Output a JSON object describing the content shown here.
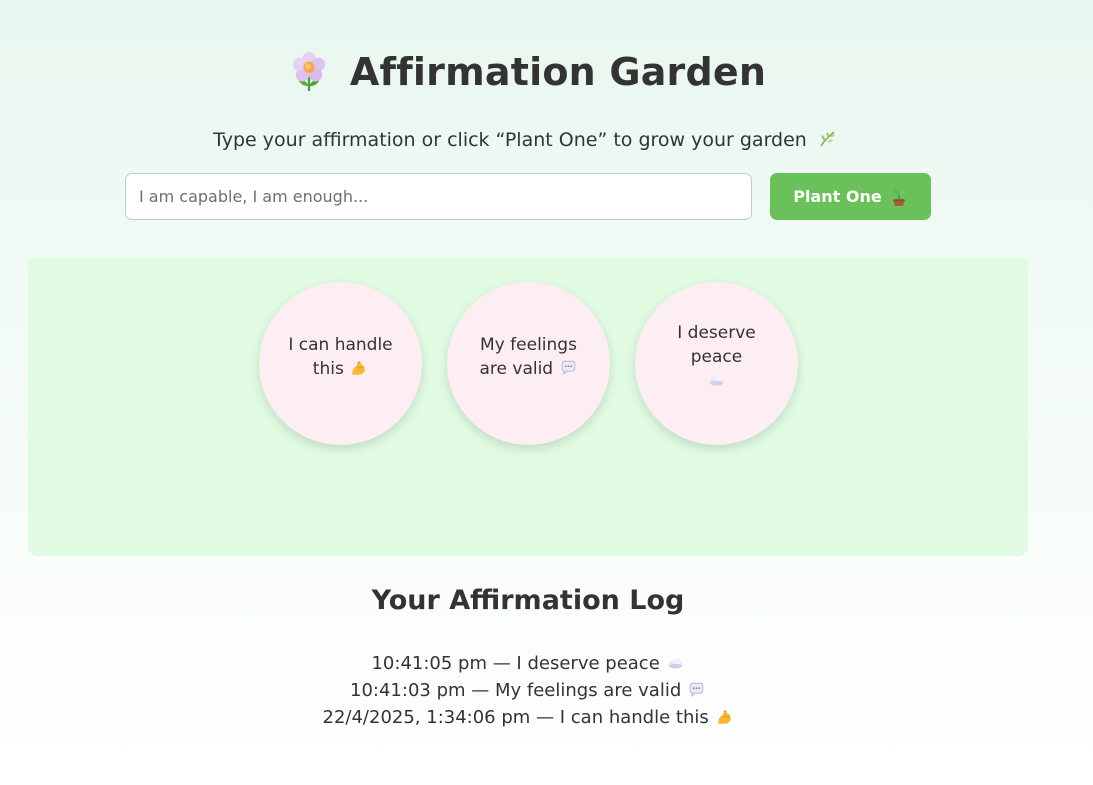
{
  "header": {
    "title": "Affirmation Garden",
    "title_icon": "flower-icon",
    "subtitle": "Type your affirmation or click “Plant One” to grow your garden",
    "subtitle_icon": "leaf-icon"
  },
  "form": {
    "input_placeholder": "I am capable, I am enough...",
    "input_value": "",
    "button_label": "Plant One",
    "button_icon": "sprout-icon"
  },
  "garden": {
    "affirmations": [
      {
        "text": "I can handle this",
        "icon": "flexed-biceps-icon"
      },
      {
        "text": "My feelings are valid",
        "icon": "speech-bubble-icon"
      },
      {
        "text": "I deserve peace",
        "icon": "cloud-icon"
      }
    ]
  },
  "log": {
    "title": "Your Affirmation Log",
    "entries": [
      {
        "text": "10:41:05 pm — I deserve peace",
        "icon": "cloud-icon"
      },
      {
        "text": "10:41:03 pm — My feelings are valid",
        "icon": "speech-bubble-icon"
      },
      {
        "text": "22/4/2025, 1:34:06 pm — I can handle this",
        "icon": "flexed-biceps-icon"
      }
    ]
  },
  "colors": {
    "accent_green": "#6ac15a",
    "garden_bg": "#e0fbe2",
    "bubble_bg": "#fdeef3",
    "text": "#333333"
  }
}
